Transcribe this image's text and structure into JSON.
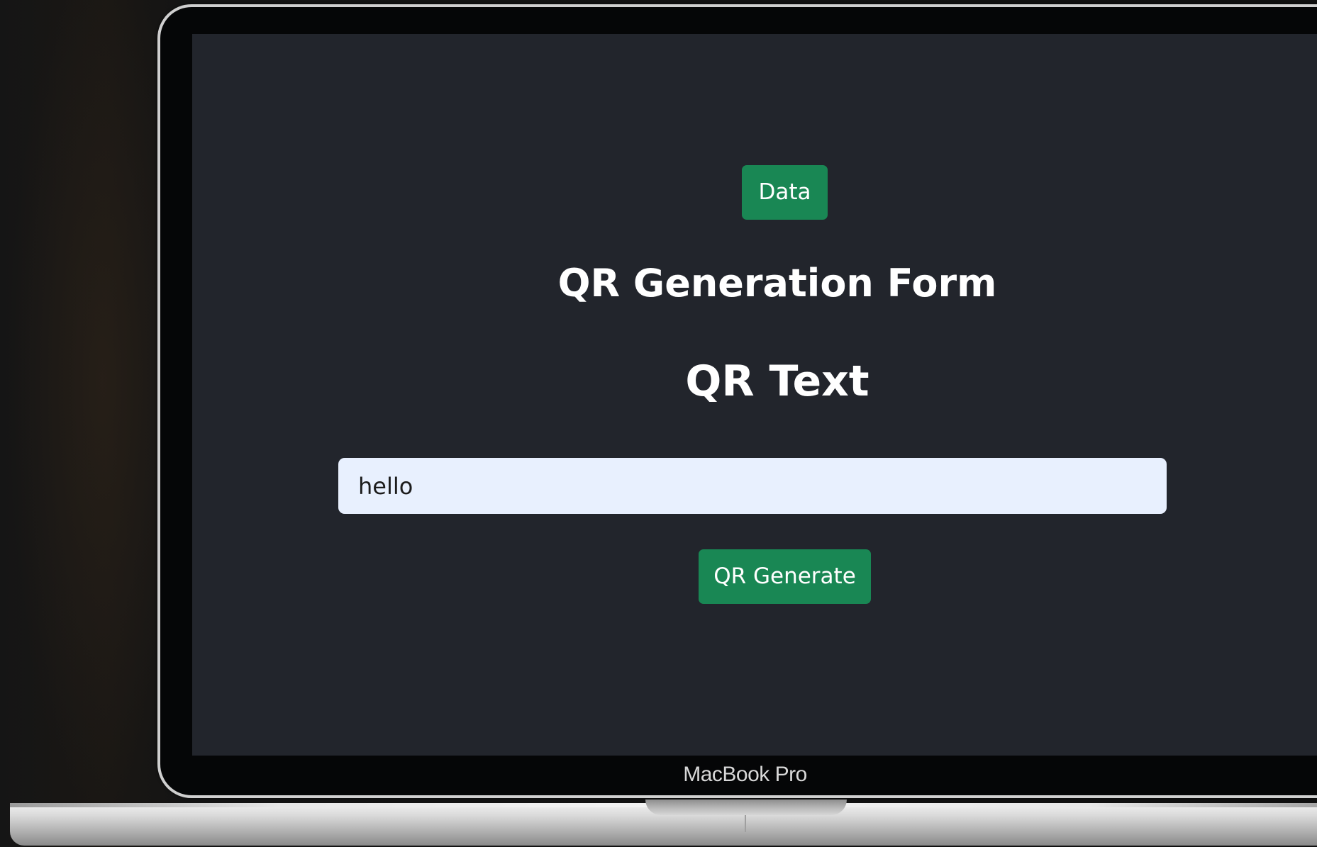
{
  "app": {
    "heading": "QR Generation Form",
    "field_heading": "QR Text",
    "data_button_label": "Data",
    "qr_input": {
      "value": "hello",
      "placeholder": ""
    },
    "generate_button_label": "QR Generate"
  },
  "device": {
    "brand_label": "MacBook Pro"
  },
  "colors": {
    "button_green": "#198754",
    "screen_background": "#22252c",
    "input_background": "#e8f0fe",
    "heading_text": "#ffffff"
  }
}
